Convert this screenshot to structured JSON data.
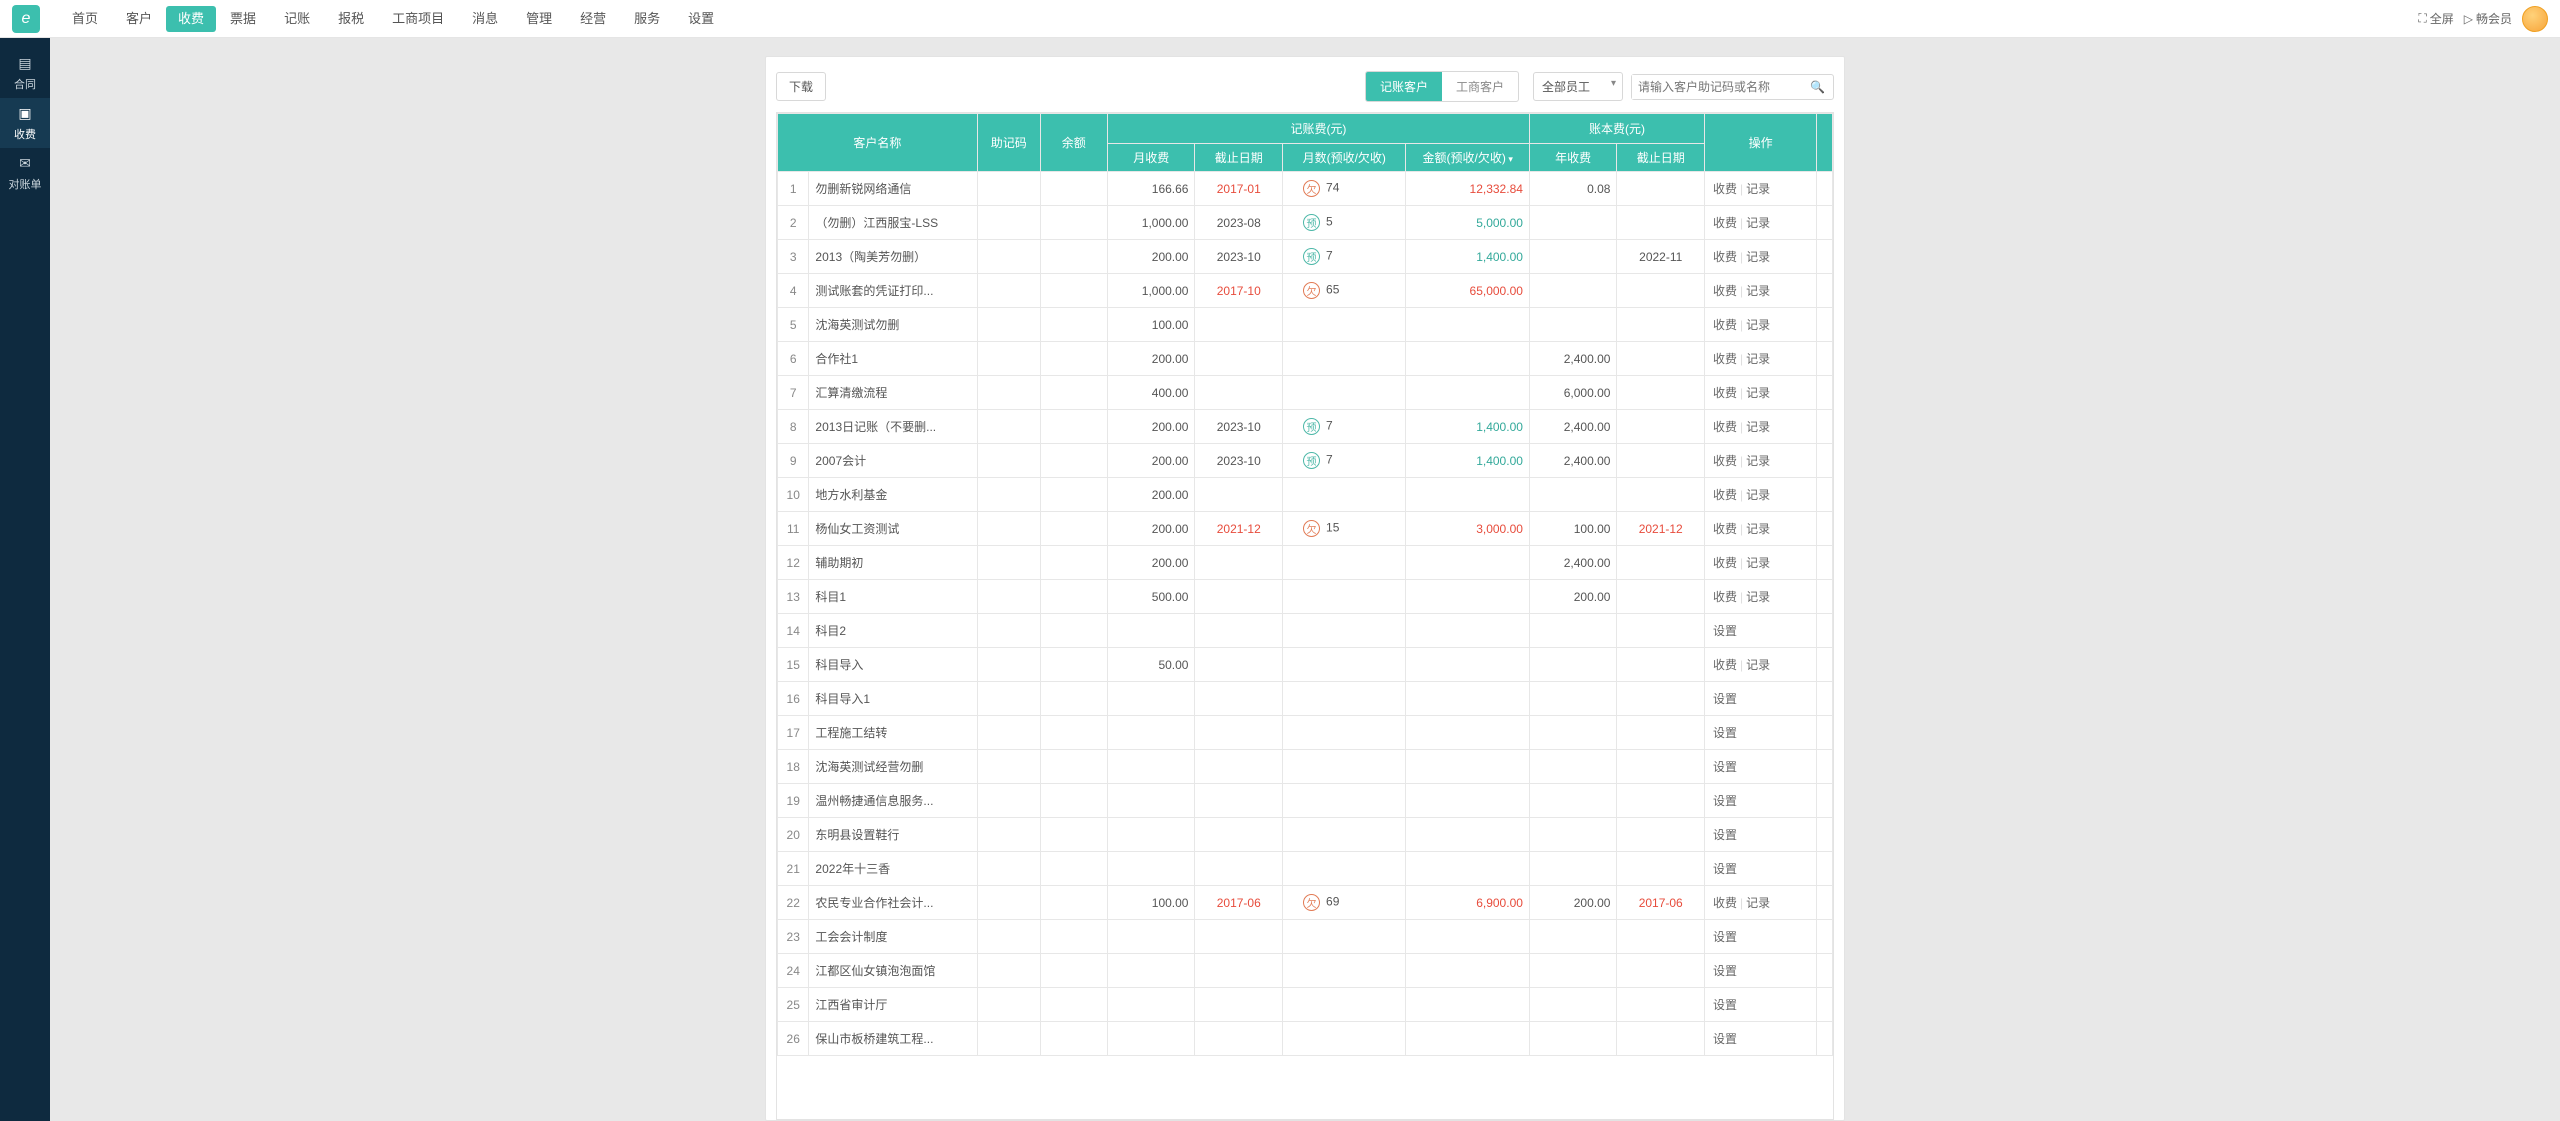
{
  "topnav": [
    "首页",
    "客户",
    "收费",
    "票据",
    "记账",
    "报税",
    "工商项目",
    "消息",
    "管理",
    "经营",
    "服务",
    "设置"
  ],
  "topnav_active": 2,
  "topright": {
    "fullscreen": "全屏",
    "vip": "畅会员"
  },
  "sidebar": [
    {
      "icon": "▤",
      "label": "合同"
    },
    {
      "icon": "▣",
      "label": "收费"
    },
    {
      "icon": "✉",
      "label": "对账单"
    }
  ],
  "sidebar_active": 1,
  "toolbar": {
    "download": "下载",
    "tab_jz": "记账客户",
    "tab_gs": "工商客户",
    "staff_select": "全部员工",
    "search_placeholder": "请输入客户助记码或名称"
  },
  "thead": {
    "name": "客户名称",
    "code": "助记码",
    "bal": "余额",
    "group_jz": "记账费(元)",
    "group_zb": "账本费(元)",
    "ops": "操作",
    "mfee": "月收费",
    "edate": "截止日期",
    "months": "月数(预收/欠收)",
    "amt": "金额(预收/欠收)",
    "yfee": "年收费",
    "ydate": "截止日期"
  },
  "op_labels": {
    "fee": "收费",
    "rec": "记录",
    "set": "设置"
  },
  "rows": [
    {
      "i": 1,
      "name": "勿删新锐网络通信",
      "mfee": "166.66",
      "edate": "2017-01",
      "edc": "red",
      "b": "ow",
      "months": "74",
      "amt": "12,332.84",
      "amtc": "red",
      "yfee": "0.08",
      "ydate": "",
      "ops": "fr"
    },
    {
      "i": 2,
      "name": "（勿删）江西服宝-LSS",
      "mfee": "1,000.00",
      "edate": "2023-08",
      "edc": "",
      "b": "pp",
      "months": "5",
      "amt": "5,000.00",
      "amtc": "teal",
      "yfee": "",
      "ydate": "",
      "ops": "fr"
    },
    {
      "i": 3,
      "name": "2013（陶美芳勿删）",
      "mfee": "200.00",
      "edate": "2023-10",
      "edc": "",
      "b": "pp",
      "months": "7",
      "amt": "1,400.00",
      "amtc": "teal",
      "yfee": "",
      "ydate": "2022-11",
      "ops": "fr"
    },
    {
      "i": 4,
      "name": "测试账套的凭证打印...",
      "mfee": "1,000.00",
      "edate": "2017-10",
      "edc": "red",
      "b": "ow",
      "months": "65",
      "amt": "65,000.00",
      "amtc": "red",
      "yfee": "",
      "ydate": "",
      "ops": "fr"
    },
    {
      "i": 5,
      "name": "沈海英测试勿删",
      "mfee": "100.00",
      "edate": "",
      "edc": "",
      "b": "",
      "months": "",
      "amt": "",
      "amtc": "",
      "yfee": "",
      "ydate": "",
      "ops": "fr"
    },
    {
      "i": 6,
      "name": "合作社1",
      "mfee": "200.00",
      "edate": "",
      "edc": "",
      "b": "",
      "months": "",
      "amt": "",
      "amtc": "",
      "yfee": "2,400.00",
      "ydate": "",
      "ops": "fr"
    },
    {
      "i": 7,
      "name": "汇算清缴流程",
      "mfee": "400.00",
      "edate": "",
      "edc": "",
      "b": "",
      "months": "",
      "amt": "",
      "amtc": "",
      "yfee": "6,000.00",
      "ydate": "",
      "ops": "fr"
    },
    {
      "i": 8,
      "name": "2013日记账（不要删...",
      "mfee": "200.00",
      "edate": "2023-10",
      "edc": "",
      "b": "pp",
      "months": "7",
      "amt": "1,400.00",
      "amtc": "teal",
      "yfee": "2,400.00",
      "ydate": "",
      "ops": "fr"
    },
    {
      "i": 9,
      "name": "2007会计",
      "mfee": "200.00",
      "edate": "2023-10",
      "edc": "",
      "b": "pp",
      "months": "7",
      "amt": "1,400.00",
      "amtc": "teal",
      "yfee": "2,400.00",
      "ydate": "",
      "ops": "fr"
    },
    {
      "i": 10,
      "name": "地方水利基金",
      "mfee": "200.00",
      "edate": "",
      "edc": "",
      "b": "",
      "months": "",
      "amt": "",
      "amtc": "",
      "yfee": "",
      "ydate": "",
      "ops": "fr"
    },
    {
      "i": 11,
      "name": "杨仙女工资测试",
      "mfee": "200.00",
      "edate": "2021-12",
      "edc": "red",
      "b": "ow",
      "months": "15",
      "amt": "3,000.00",
      "amtc": "red",
      "yfee": "100.00",
      "ydate": "2021-12",
      "ydc": "red",
      "ops": "fr"
    },
    {
      "i": 12,
      "name": "辅助期初",
      "mfee": "200.00",
      "edate": "",
      "edc": "",
      "b": "",
      "months": "",
      "amt": "",
      "amtc": "",
      "yfee": "2,400.00",
      "ydate": "",
      "ops": "fr"
    },
    {
      "i": 13,
      "name": "科目1",
      "mfee": "500.00",
      "edate": "",
      "edc": "",
      "b": "",
      "months": "",
      "amt": "",
      "amtc": "",
      "yfee": "200.00",
      "ydate": "",
      "ops": "fr"
    },
    {
      "i": 14,
      "name": "科目2",
      "mfee": "",
      "edate": "",
      "edc": "",
      "b": "",
      "months": "",
      "amt": "",
      "amtc": "",
      "yfee": "",
      "ydate": "",
      "ops": "s"
    },
    {
      "i": 15,
      "name": "科目导入",
      "mfee": "50.00",
      "edate": "",
      "edc": "",
      "b": "",
      "months": "",
      "amt": "",
      "amtc": "",
      "yfee": "",
      "ydate": "",
      "ops": "fr"
    },
    {
      "i": 16,
      "name": "科目导入1",
      "mfee": "",
      "edate": "",
      "edc": "",
      "b": "",
      "months": "",
      "amt": "",
      "amtc": "",
      "yfee": "",
      "ydate": "",
      "ops": "s"
    },
    {
      "i": 17,
      "name": "工程施工结转",
      "mfee": "",
      "edate": "",
      "edc": "",
      "b": "",
      "months": "",
      "amt": "",
      "amtc": "",
      "yfee": "",
      "ydate": "",
      "ops": "s"
    },
    {
      "i": 18,
      "name": "沈海英测试经营勿删",
      "mfee": "",
      "edate": "",
      "edc": "",
      "b": "",
      "months": "",
      "amt": "",
      "amtc": "",
      "yfee": "",
      "ydate": "",
      "ops": "s"
    },
    {
      "i": 19,
      "name": "温州畅捷通信息服务...",
      "mfee": "",
      "edate": "",
      "edc": "",
      "b": "",
      "months": "",
      "amt": "",
      "amtc": "",
      "yfee": "",
      "ydate": "",
      "ops": "s"
    },
    {
      "i": 20,
      "name": "东明县设置鞋行",
      "mfee": "",
      "edate": "",
      "edc": "",
      "b": "",
      "months": "",
      "amt": "",
      "amtc": "",
      "yfee": "",
      "ydate": "",
      "ops": "s"
    },
    {
      "i": 21,
      "name": "2022年十三香",
      "mfee": "",
      "edate": "",
      "edc": "",
      "b": "",
      "months": "",
      "amt": "",
      "amtc": "",
      "yfee": "",
      "ydate": "",
      "ops": "s"
    },
    {
      "i": 22,
      "name": "农民专业合作社会计...",
      "mfee": "100.00",
      "edate": "2017-06",
      "edc": "red",
      "b": "ow",
      "months": "69",
      "amt": "6,900.00",
      "amtc": "red",
      "yfee": "200.00",
      "ydate": "2017-06",
      "ydc": "red",
      "ops": "fr"
    },
    {
      "i": 23,
      "name": "工会会计制度",
      "mfee": "",
      "edate": "",
      "edc": "",
      "b": "",
      "months": "",
      "amt": "",
      "amtc": "",
      "yfee": "",
      "ydate": "",
      "ops": "s"
    },
    {
      "i": 24,
      "name": "江都区仙女镇泡泡面馆",
      "mfee": "",
      "edate": "",
      "edc": "",
      "b": "",
      "months": "",
      "amt": "",
      "amtc": "",
      "yfee": "",
      "ydate": "",
      "ops": "s"
    },
    {
      "i": 25,
      "name": "江西省审计厅",
      "mfee": "",
      "edate": "",
      "edc": "",
      "b": "",
      "months": "",
      "amt": "",
      "amtc": "",
      "yfee": "",
      "ydate": "",
      "ops": "s"
    },
    {
      "i": 26,
      "name": "保山市板桥建筑工程...",
      "mfee": "",
      "edate": "",
      "edc": "",
      "b": "",
      "months": "",
      "amt": "",
      "amtc": "",
      "yfee": "",
      "ydate": "",
      "ops": "s"
    }
  ]
}
